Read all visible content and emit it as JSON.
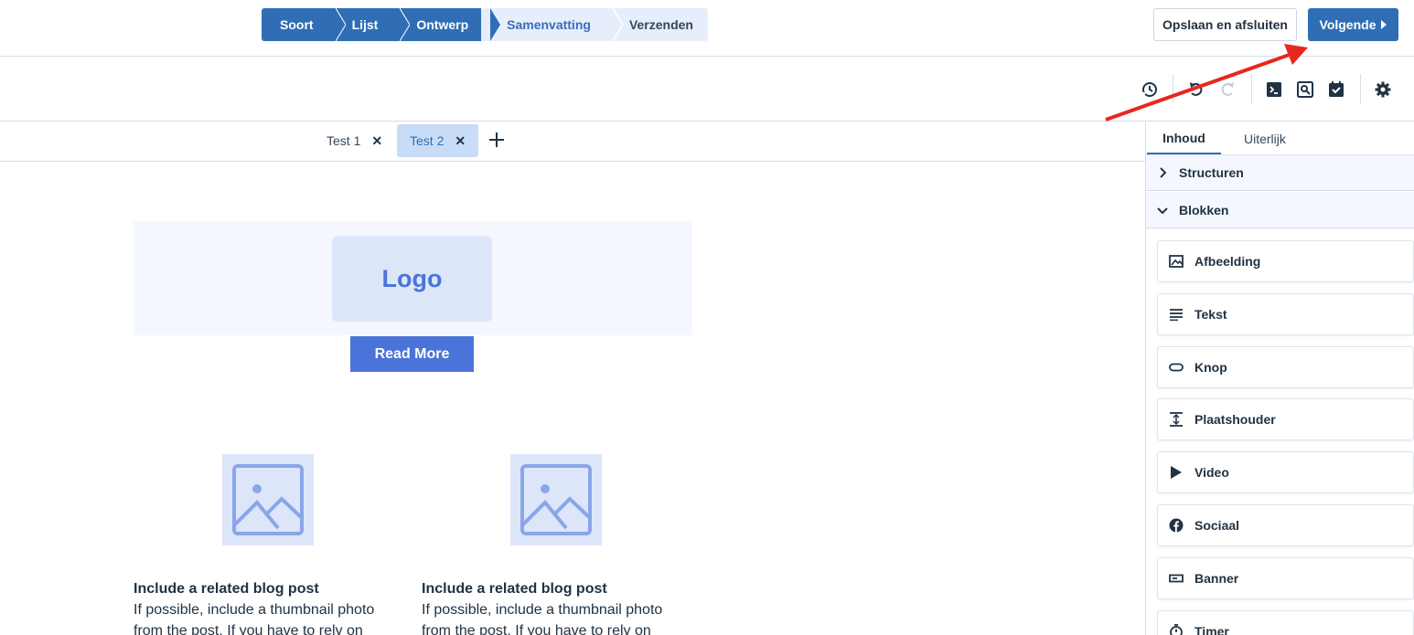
{
  "steps": [
    {
      "label": "Soort",
      "state": "active"
    },
    {
      "label": "Lijst",
      "state": "active"
    },
    {
      "label": "Ontwerp",
      "state": "active"
    },
    {
      "label": "Samenvatting",
      "state": "current"
    },
    {
      "label": "Verzenden",
      "state": "inactive"
    }
  ],
  "header": {
    "save_label": "Opslaan en afsluiten",
    "next_label": "Volgende"
  },
  "toolbar": {
    "icons": [
      "history-icon",
      "undo-icon",
      "redo-icon",
      "code-icon",
      "preview-icon",
      "checklist-icon",
      "settings-icon"
    ]
  },
  "tabs": [
    {
      "label": "Test 1",
      "selected": false
    },
    {
      "label": "Test 2",
      "selected": true
    }
  ],
  "email": {
    "logo_text": "Logo",
    "button_label": "Read More",
    "posts": [
      {
        "title": "Include a related blog post",
        "line1": "If possible, include a thumbnail photo",
        "line2": "from the post. If you have to rely on"
      },
      {
        "title": "Include a related blog post",
        "line1": "If possible, include a thumbnail photo",
        "line2": "from the post. If you have to rely on"
      }
    ]
  },
  "panel": {
    "tabs": {
      "content": "Inhoud",
      "appearance": "Uiterlijk"
    },
    "sections": {
      "structures": "Structuren",
      "blocks": "Blokken"
    },
    "blocks": [
      {
        "label": "Afbeelding",
        "icon": "image-icon"
      },
      {
        "label": "Tekst",
        "icon": "text-icon"
      },
      {
        "label": "Knop",
        "icon": "button-icon"
      },
      {
        "label": "Plaatshouder",
        "icon": "spacer-icon"
      },
      {
        "label": "Video",
        "icon": "video-icon"
      },
      {
        "label": "Sociaal",
        "icon": "facebook-icon"
      },
      {
        "label": "Banner",
        "icon": "banner-icon"
      },
      {
        "label": "Timer",
        "icon": "timer-icon"
      }
    ]
  },
  "colors": {
    "accent": "#2f6eb5",
    "email_accent": "#4a74d9",
    "annotation": "#e8271f"
  }
}
